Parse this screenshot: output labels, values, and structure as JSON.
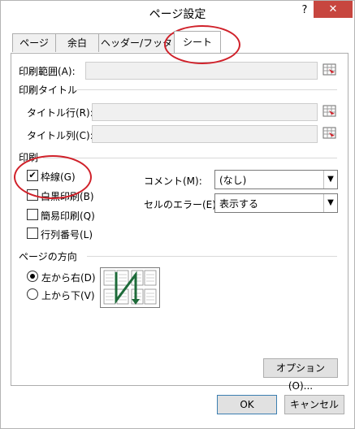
{
  "window": {
    "title": "ページ設定",
    "help": "?",
    "close": "✕"
  },
  "tabs": [
    {
      "label": "ページ"
    },
    {
      "label": "余白"
    },
    {
      "label": "ヘッダー/フッター"
    },
    {
      "label": "シート",
      "active": true
    }
  ],
  "print_area": {
    "label": "印刷範囲(A):",
    "value": ""
  },
  "print_titles": {
    "heading": "印刷タイトル",
    "rows_label": "タイトル行(R):",
    "cols_label": "タイトル列(C):",
    "rows_value": "",
    "cols_value": ""
  },
  "print": {
    "heading": "印刷",
    "gridlines": {
      "label": "枠線(G)",
      "checked": true
    },
    "bw": {
      "label": "白黒印刷(B)",
      "checked": false
    },
    "draft": {
      "label": "簡易印刷(Q)",
      "checked": false
    },
    "headings": {
      "label": "行列番号(L)",
      "checked": false
    },
    "comments": {
      "label": "コメント(M):",
      "value": "(なし)"
    },
    "errors": {
      "label": "セルのエラー(E):",
      "value": "表示する"
    }
  },
  "page_order": {
    "heading": "ページの方向",
    "down_then_over": {
      "label": "左から右(D)",
      "selected": true
    },
    "over_then_down": {
      "label": "上から下(V)",
      "selected": false
    }
  },
  "buttons": {
    "options": "オプション(O)...",
    "ok": "OK",
    "cancel": "キャンセル"
  },
  "icons": {
    "range_picker": "range-select-icon",
    "check": "✔"
  },
  "colors": {
    "close_bg": "#c7463f",
    "annotation": "#d0212a",
    "preview_arrow": "#1e6b3a"
  }
}
